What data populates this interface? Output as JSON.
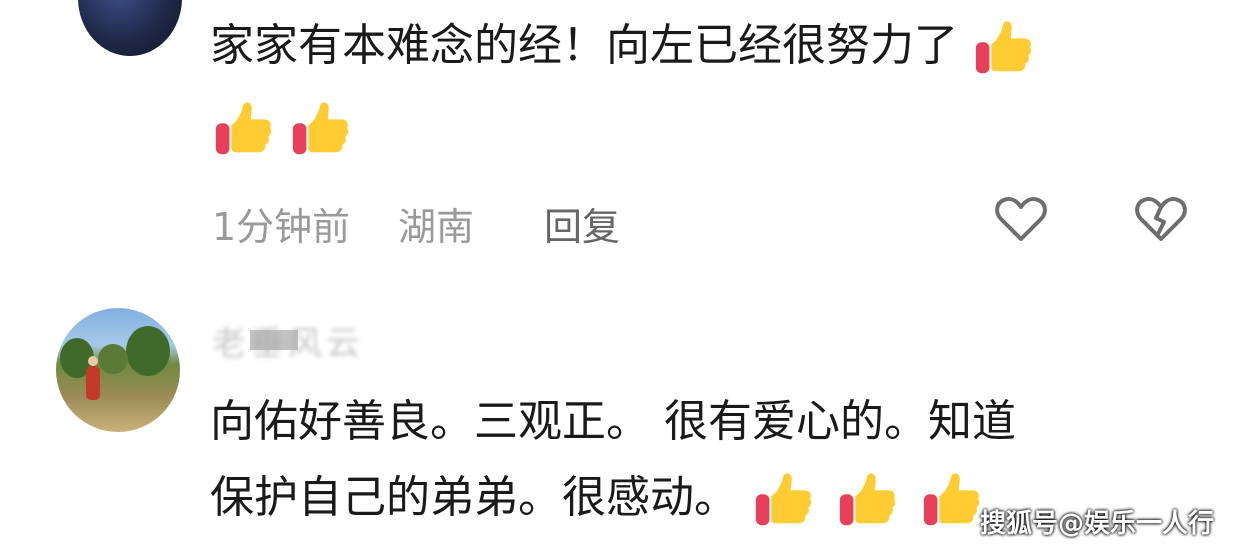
{
  "comment1": {
    "text": "家家有本难念的经！向左已经很努力了",
    "time": "1分钟前",
    "location": "湖南",
    "reply_label": "回复"
  },
  "comment2": {
    "username": "老垂风云",
    "line1": "向佑好善良。三观正。 很有爱心的。知道",
    "line2": "保护自己的弟弟。很感动。"
  },
  "icons": {
    "thumb": "thumbs-up-emoji",
    "like": "heart-outline-icon",
    "dislike": "broken-heart-icon"
  },
  "watermark": "搜狐号@娱乐一人行",
  "colors": {
    "thumb_yellow": "#ffcc33",
    "thumb_red": "#e8405a",
    "meta_gray": "#9a9a9a"
  }
}
